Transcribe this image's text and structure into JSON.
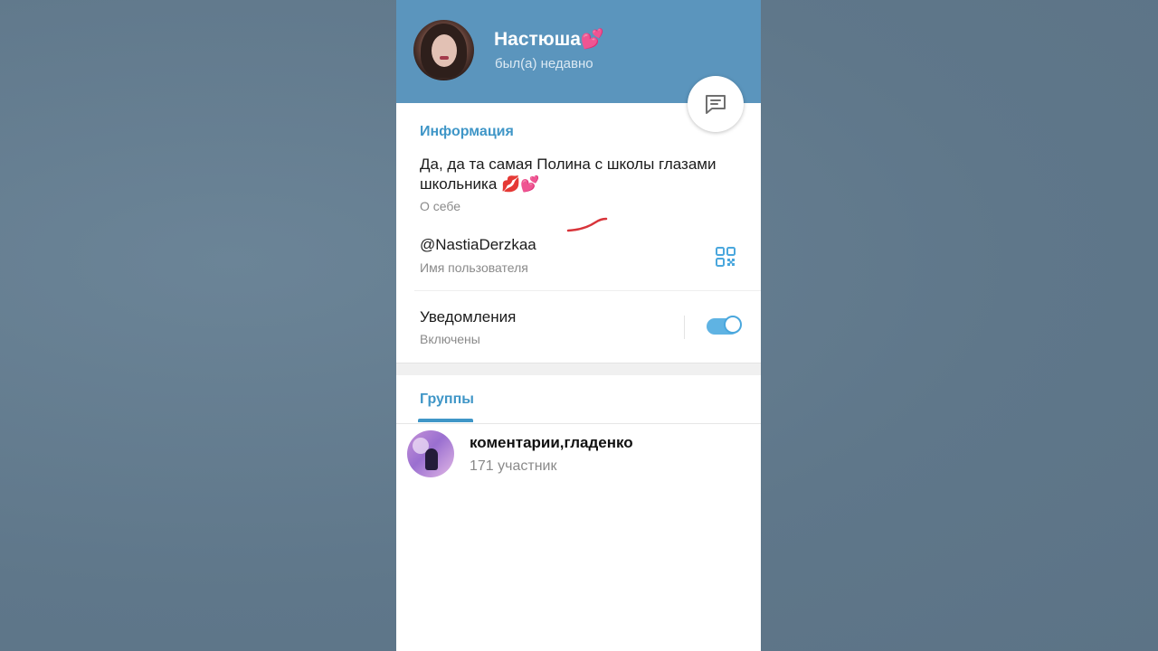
{
  "profile": {
    "name": "Настюша💕",
    "status": "был(а) недавно"
  },
  "info": {
    "section_title": "Информация",
    "bio_line1": "Да, да та самая Полина с школы глазами",
    "bio_line2": "школьника 💋💕",
    "bio_label": "О себе",
    "username": "@NastiaDerzkaa",
    "username_label": "Имя пользователя",
    "notifications": "Уведомления",
    "notifications_state": "Включены",
    "notifications_on": true
  },
  "tabs": {
    "groups_label": "Группы"
  },
  "groups": [
    {
      "name": "коментарии,гладенко",
      "members": "171 участник"
    }
  ],
  "colors": {
    "header": "#5b95bd",
    "accent": "#3f96c7",
    "toggle": "#5fb3e3"
  }
}
